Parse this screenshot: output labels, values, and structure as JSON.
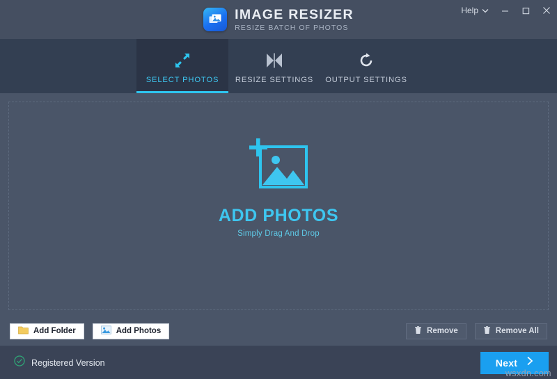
{
  "window": {
    "title": "IMAGE RESIZER",
    "subtitle": "RESIZE BATCH OF PHOTOS",
    "app_icon": "photo-stack-icon",
    "help_label": "Help",
    "help_chevron_icon": "chevron-down-icon",
    "minimize_icon": "minimize-icon",
    "maximize_icon": "maximize-icon",
    "close_icon": "close-icon"
  },
  "tabs": [
    {
      "label": "SELECT PHOTOS",
      "icon": "resize-arrows-icon",
      "active": true
    },
    {
      "label": "RESIZE SETTINGS",
      "icon": "collapse-triangles-icon",
      "active": false
    },
    {
      "label": "OUTPUT SETTINGS",
      "icon": "refresh-circle-icon",
      "active": false
    }
  ],
  "dropzone": {
    "icon": "add-photo-icon",
    "title": "ADD PHOTOS",
    "subtitle": "Simply Drag And Drop"
  },
  "toolbar": {
    "add_folder_label": "Add Folder",
    "add_folder_icon": "folder-icon",
    "add_photos_label": "Add Photos",
    "add_photos_icon": "photo-icon",
    "remove_label": "Remove",
    "remove_icon": "trash-icon",
    "remove_all_label": "Remove All",
    "remove_all_icon": "trash-icon"
  },
  "footer": {
    "status_icon": "check-circle-icon",
    "status_label": "Registered Version",
    "next_label": "Next",
    "next_icon": "chevron-right-icon",
    "watermark": "wsxdn.com"
  },
  "colors": {
    "accent": "#2ec4ee",
    "primary_button": "#1a9ff0",
    "header_bg": "#454f61",
    "tabbar_bg": "#333f52",
    "active_tab_bg": "#2b3446",
    "body_bg": "#4a5568",
    "footer_bg": "#3a4356",
    "status_green": "#2fa676"
  }
}
